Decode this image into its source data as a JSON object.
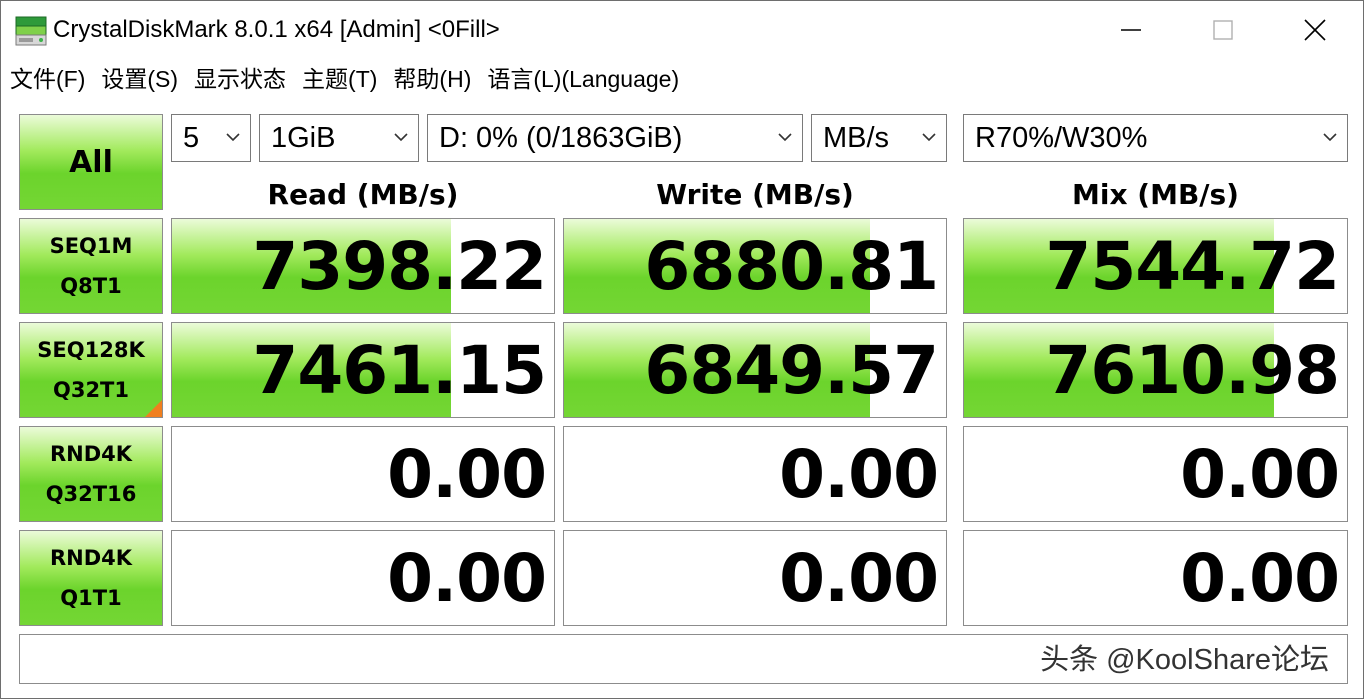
{
  "window": {
    "title": "CrystalDiskMark 8.0.1 x64 [Admin] <0Fill>",
    "icon": "crystaldiskmark-disk-icon",
    "controls": [
      "minimize-icon",
      "maximize-icon",
      "close-icon"
    ]
  },
  "menu": {
    "file": "文件(F)",
    "settings": "设置(S)",
    "display": "显示状态",
    "theme": "主题(T)",
    "help": "帮助(H)",
    "language": "语言(L)(Language)"
  },
  "controls": {
    "all_button": "All",
    "count": "5",
    "size": "1GiB",
    "drive": "D: 0% (0/1863GiB)",
    "unit": "MB/s",
    "mix": "R70%/W30%"
  },
  "headers": {
    "read": "Read (MB/s)",
    "write": "Write (MB/s)",
    "mix": "Mix (MB/s)"
  },
  "rows": [
    {
      "line1": "SEQ1M",
      "line2": "Q8T1",
      "read": "7398.22",
      "write": "6880.81",
      "mix": "7544.72",
      "read_fill": 0.73,
      "write_fill": 0.8,
      "mix_fill": 0.81
    },
    {
      "line1": "SEQ128K",
      "line2": "Q32T1",
      "read": "7461.15",
      "write": "6849.57",
      "mix": "7610.98",
      "read_fill": 0.73,
      "write_fill": 0.8,
      "mix_fill": 0.81
    },
    {
      "line1": "RND4K",
      "line2": "Q32T16",
      "read": "0.00",
      "write": "0.00",
      "mix": "0.00",
      "read_fill": 0,
      "write_fill": 0,
      "mix_fill": 0
    },
    {
      "line1": "RND4K",
      "line2": "Q1T1",
      "read": "0.00",
      "write": "0.00",
      "mix": "0.00",
      "read_fill": 0,
      "write_fill": 0,
      "mix_fill": 0
    }
  ],
  "comment": {
    "text": "",
    "watermark": "头条 @KoolShare论坛"
  },
  "colors": {
    "bar_green": "#6cd42c",
    "marker_orange": "#f07f1f"
  }
}
